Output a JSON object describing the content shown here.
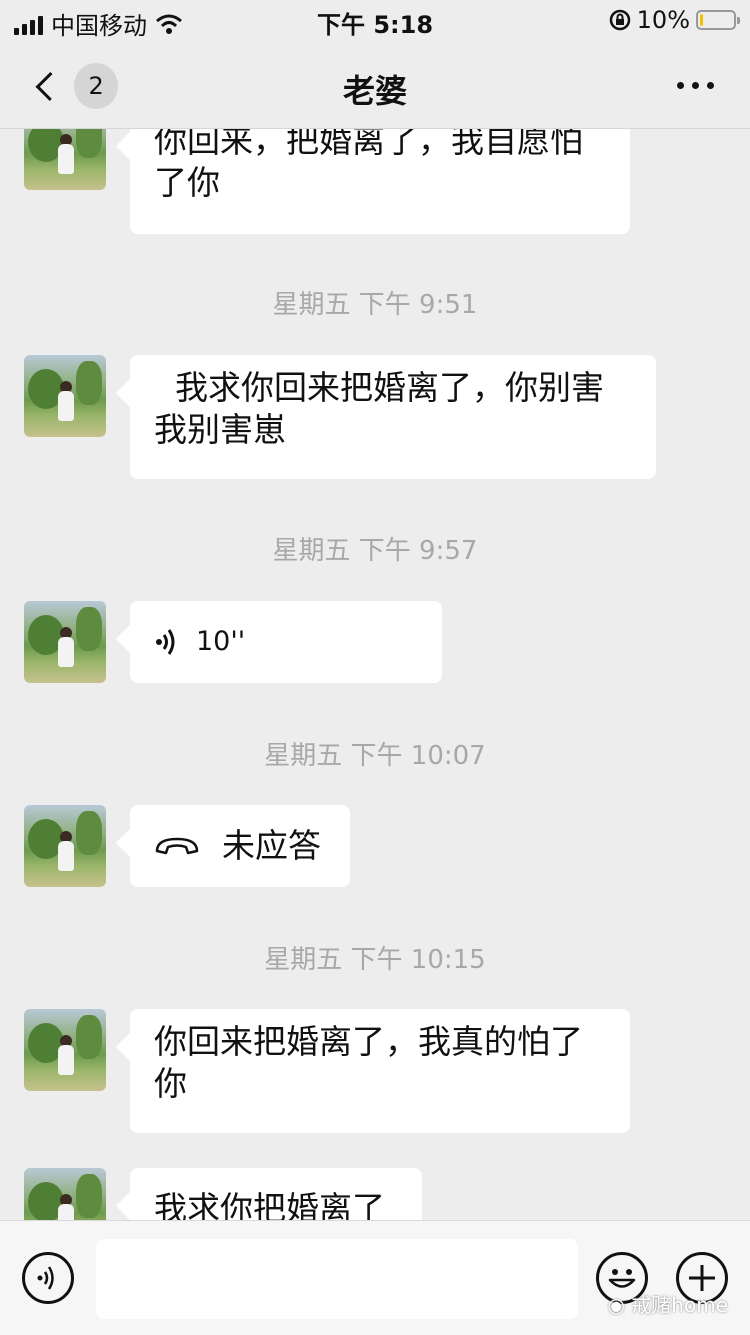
{
  "status_bar": {
    "carrier": "中国移动",
    "time": "下午 5:18",
    "battery": "10%",
    "battery_level": 0.1
  },
  "nav": {
    "unread_count": "2",
    "title": "老婆"
  },
  "messages": [
    {
      "type": "text",
      "line1": "你回来，把婚离了，我自愿怕",
      "line2": "了你"
    },
    {
      "type": "time",
      "text": "星期五 下午 9:51"
    },
    {
      "type": "text",
      "line1": "  我求你回来把婚离了，你别害",
      "line2": "我别害崽"
    },
    {
      "type": "time",
      "text": "星期五 下午 9:57"
    },
    {
      "type": "voice",
      "duration": "10''"
    },
    {
      "type": "time",
      "text": "星期五 下午 10:07"
    },
    {
      "type": "call",
      "text": "未应答"
    },
    {
      "type": "time",
      "text": "星期五 下午 10:15"
    },
    {
      "type": "text",
      "line1": "你回来把婚离了，我真的怕了",
      "line2": "你"
    },
    {
      "type": "text",
      "line1": "我求你把婚离了"
    }
  ],
  "input_bar": {
    "watermark": "戒赌home"
  },
  "icons": [
    "signal-icon",
    "wifi-icon",
    "lock-rotation-icon",
    "battery-icon",
    "back-icon",
    "more-icon",
    "voice-icon",
    "missed-call-icon",
    "voice-input-icon",
    "emoji-icon",
    "add-icon",
    "wechat-logo-icon"
  ]
}
